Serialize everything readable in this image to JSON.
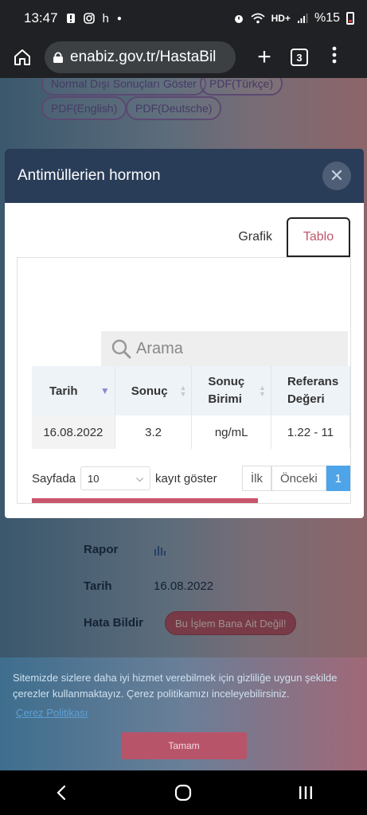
{
  "status_bar": {
    "time": "13:47",
    "battery_text": "%15"
  },
  "browser": {
    "url": "enabiz.gov.tr/HastaBil",
    "tab_count": "3"
  },
  "page": {
    "pill_buttons": [
      "Normal Dışı Sonuçları Göster",
      "PDF(Türkçe)",
      "PDF(English)",
      "PDF(Deutsche)"
    ],
    "rapor_label": "Rapor",
    "tarih_label": "Tarih",
    "tarih_value": "16.08.2022",
    "hata_label": "Hata Bildir",
    "hata_button": "Bu İşlem Bana Ait Değil!"
  },
  "modal": {
    "title": "Antimüllerien hormon",
    "tabs": {
      "grafik": "Grafik",
      "tablo": "Tablo"
    },
    "search_placeholder": "Arama",
    "table": {
      "headers": [
        "Tarih",
        "Sonuç",
        "Sonuç Birimi",
        "Referans Değeri"
      ],
      "rows": [
        [
          "16.08.2022",
          "3.2",
          "ng/mL",
          "1.22 - 11"
        ]
      ]
    },
    "pager": {
      "prefix": "Sayfada",
      "page_size": "10",
      "suffix": "kayıt göster",
      "first": "İlk",
      "prev": "Önceki",
      "current": "1"
    }
  },
  "cookie": {
    "text": "Sitemizde sizlere daha iyi hizmet verebilmek için gizliliğe uygun şekilde çerezler kullanmaktayız. Çerez politikamızı inceleyebilirsiniz.",
    "link": "Çerez Politikası",
    "ok": "Tamam"
  },
  "colors": {
    "modal_header": "#2a3d58",
    "accent_pink": "#c0566a",
    "pager_active": "#4ea4e8"
  }
}
